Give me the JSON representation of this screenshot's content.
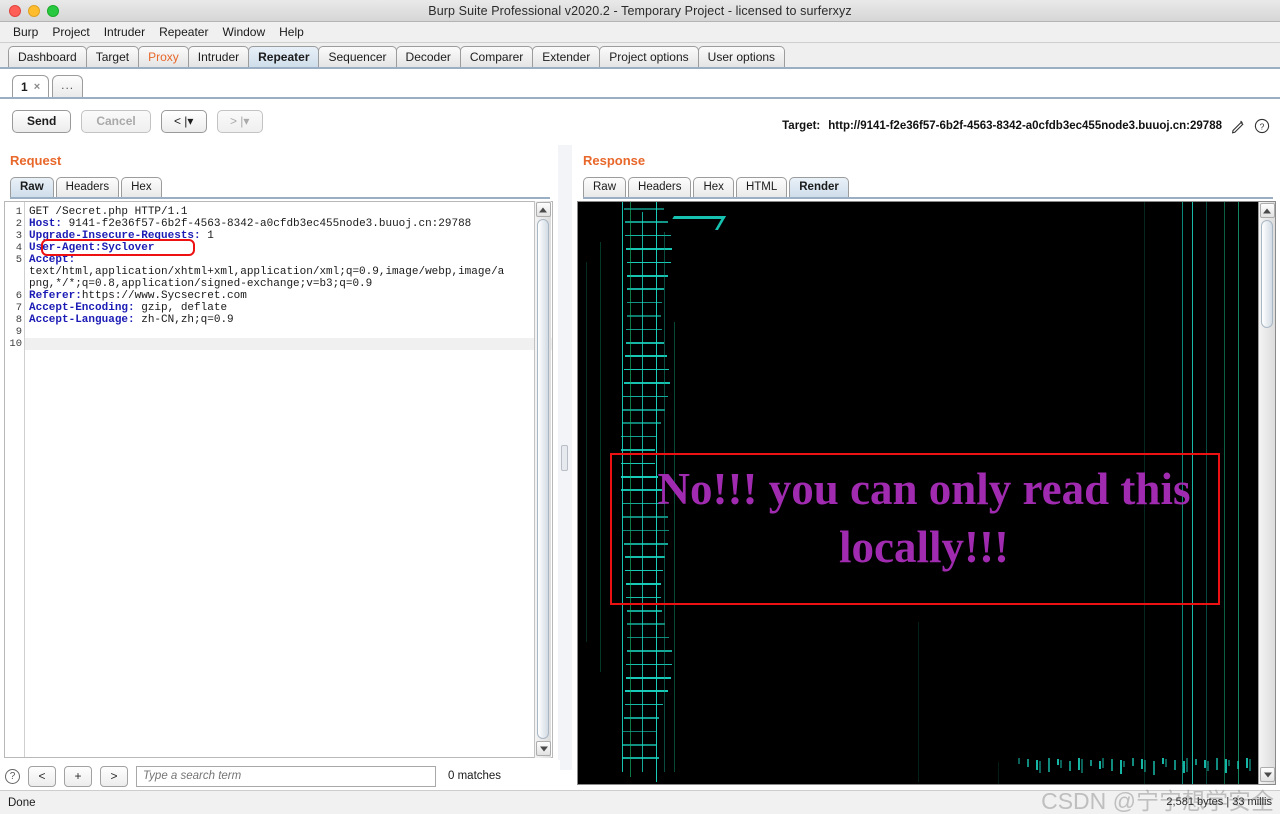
{
  "window": {
    "title": "Burp Suite Professional v2020.2 - Temporary Project - licensed to surferxyz"
  },
  "menubar": {
    "items": [
      "Burp",
      "Project",
      "Intruder",
      "Repeater",
      "Window",
      "Help"
    ]
  },
  "main_tabs": {
    "items": [
      {
        "label": "Dashboard",
        "state": "normal"
      },
      {
        "label": "Target",
        "state": "normal"
      },
      {
        "label": "Proxy",
        "state": "warn"
      },
      {
        "label": "Intruder",
        "state": "normal"
      },
      {
        "label": "Repeater",
        "state": "active"
      },
      {
        "label": "Sequencer",
        "state": "normal"
      },
      {
        "label": "Decoder",
        "state": "normal"
      },
      {
        "label": "Comparer",
        "state": "normal"
      },
      {
        "label": "Extender",
        "state": "normal"
      },
      {
        "label": "Project options",
        "state": "normal"
      },
      {
        "label": "User options",
        "state": "normal"
      }
    ]
  },
  "repeater_tabs": {
    "items": [
      {
        "label": "1",
        "close": "×",
        "active": true
      },
      {
        "label": "...",
        "active": false
      }
    ]
  },
  "toolbar": {
    "send_label": "Send",
    "cancel_label": "Cancel",
    "back_label": "< |▾",
    "forward_label": "> |▾",
    "target_label": "Target:",
    "target_url": "http://9141-f2e36f57-6b2f-4563-8342-a0cfdb3ec455node3.buuoj.cn:29788",
    "edit_icon": "pencil-icon",
    "help_icon": "question-icon"
  },
  "request": {
    "panel_label": "Request",
    "tabs": [
      {
        "label": "Raw",
        "active": true
      },
      {
        "label": "Headers",
        "active": false
      },
      {
        "label": "Hex",
        "active": false
      }
    ],
    "line_numbers": [
      "1",
      "2",
      "3",
      "4",
      "5",
      "",
      "",
      "6",
      "7",
      "8",
      "9",
      "10"
    ],
    "lines": [
      {
        "num": "1",
        "name": "",
        "rest": "GET /Secret.php HTTP/1.1"
      },
      {
        "num": "2",
        "name": "Host:",
        "rest": " 9141-f2e36f57-6b2f-4563-8342-a0cfdb3ec455node3.buuoj.cn:29788"
      },
      {
        "num": "3",
        "name": "Upgrade-Insecure-Requests:",
        "rest": " 1"
      },
      {
        "num": "4",
        "name": "User-Agent:Syclover",
        "rest": ""
      },
      {
        "num": "5",
        "name": "Accept:",
        "rest": ""
      },
      {
        "num": "",
        "name": "",
        "rest": "text/html,application/xhtml+xml,application/xml;q=0.9,image/webp,image/a"
      },
      {
        "num": "",
        "name": "",
        "rest": "png,*/*;q=0.8,application/signed-exchange;v=b3;q=0.9"
      },
      {
        "num": "6",
        "name": "Referer:",
        "rest": "https://www.Sycsecret.com"
      },
      {
        "num": "7",
        "name": "Accept-Encoding:",
        "rest": " gzip, deflate"
      },
      {
        "num": "8",
        "name": "Accept-Language:",
        "rest": " zh-CN,zh;q=0.9"
      },
      {
        "num": "9",
        "name": "",
        "rest": ""
      },
      {
        "num": "10",
        "name": "",
        "rest": ""
      }
    ],
    "highlight_note": "red-box-around-user-agent"
  },
  "response": {
    "panel_label": "Response",
    "tabs": [
      {
        "label": "Raw",
        "active": false
      },
      {
        "label": "Headers",
        "active": false
      },
      {
        "label": "Hex",
        "active": false
      },
      {
        "label": "HTML",
        "active": false
      },
      {
        "label": "Render",
        "active": true
      }
    ],
    "render": {
      "message_line1": "No!!! you can only read this",
      "message_line2": "locally!!!",
      "text_color": "#a12bb0",
      "background_color": "#000000",
      "accent_color": "#19d6c2",
      "annotation_color": "#ee1111"
    }
  },
  "searchbar": {
    "help_icon": "question-icon",
    "prev_label": "<",
    "add_label": "+",
    "next_label": ">",
    "placeholder": "Type a search term",
    "value": "",
    "matches": "0 matches"
  },
  "statusbar": {
    "status": "Done",
    "bytes": "2,581 bytes | 33 millis",
    "watermark": "CSDN @宁宁想学安全"
  },
  "colors": {
    "accent_orange": "#e8672a",
    "tab_active": "#cfdeeb",
    "render_purple": "#a12bb0",
    "annotation_red": "#ee1111"
  }
}
